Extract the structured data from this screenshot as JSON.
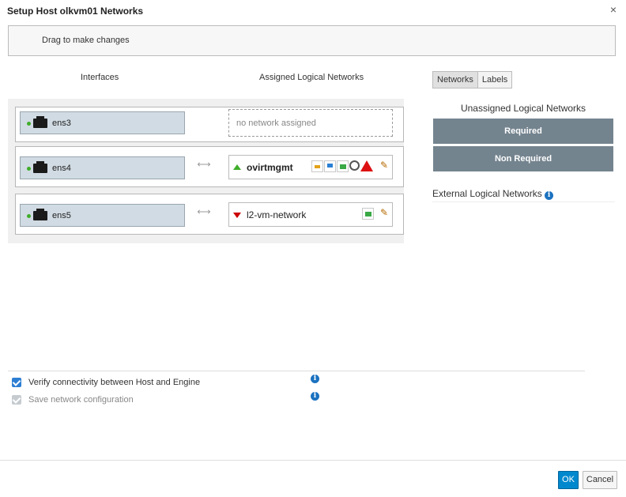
{
  "dialog": {
    "title": "Setup Host olkvm01 Networks",
    "close_icon": "×"
  },
  "banner": {
    "text": "Drag to make changes"
  },
  "columns": {
    "interfaces": "Interfaces",
    "assigned": "Assigned Logical Networks"
  },
  "interfaces": [
    {
      "name": "ens3",
      "placeholder": "no network assigned"
    },
    {
      "name": "ens4",
      "network": "ovirtmgmt",
      "status": "up"
    },
    {
      "name": "ens5",
      "network": "l2-vm-network",
      "status": "down"
    }
  ],
  "arrow": "⟷",
  "pencil": "✎",
  "side": {
    "tabs": [
      "Networks",
      "Labels"
    ],
    "unassigned_title": "Unassigned Logical Networks",
    "required": "Required",
    "non_required": "Non Required",
    "external_title": "External Logical Networks",
    "info": "i"
  },
  "options": {
    "verify": "Verify connectivity between Host and Engine",
    "save": "Save network configuration"
  },
  "buttons": {
    "ok": "OK",
    "cancel": "Cancel"
  },
  "colors": {
    "accent": "#0088ce",
    "status_up": "#3fae29",
    "status_down": "#cc0000",
    "bucket": "#74848f"
  },
  "icons": [
    "close-icon",
    "ethernet-port-icon",
    "link-status-dot-icon",
    "up-arrow-icon",
    "down-arrow-icon",
    "display-role-icon",
    "migration-role-icon",
    "vm-network-icon",
    "management-gear-icon",
    "warning-icon",
    "edit-pencil-icon",
    "info-icon",
    "checkbox-icon"
  ]
}
